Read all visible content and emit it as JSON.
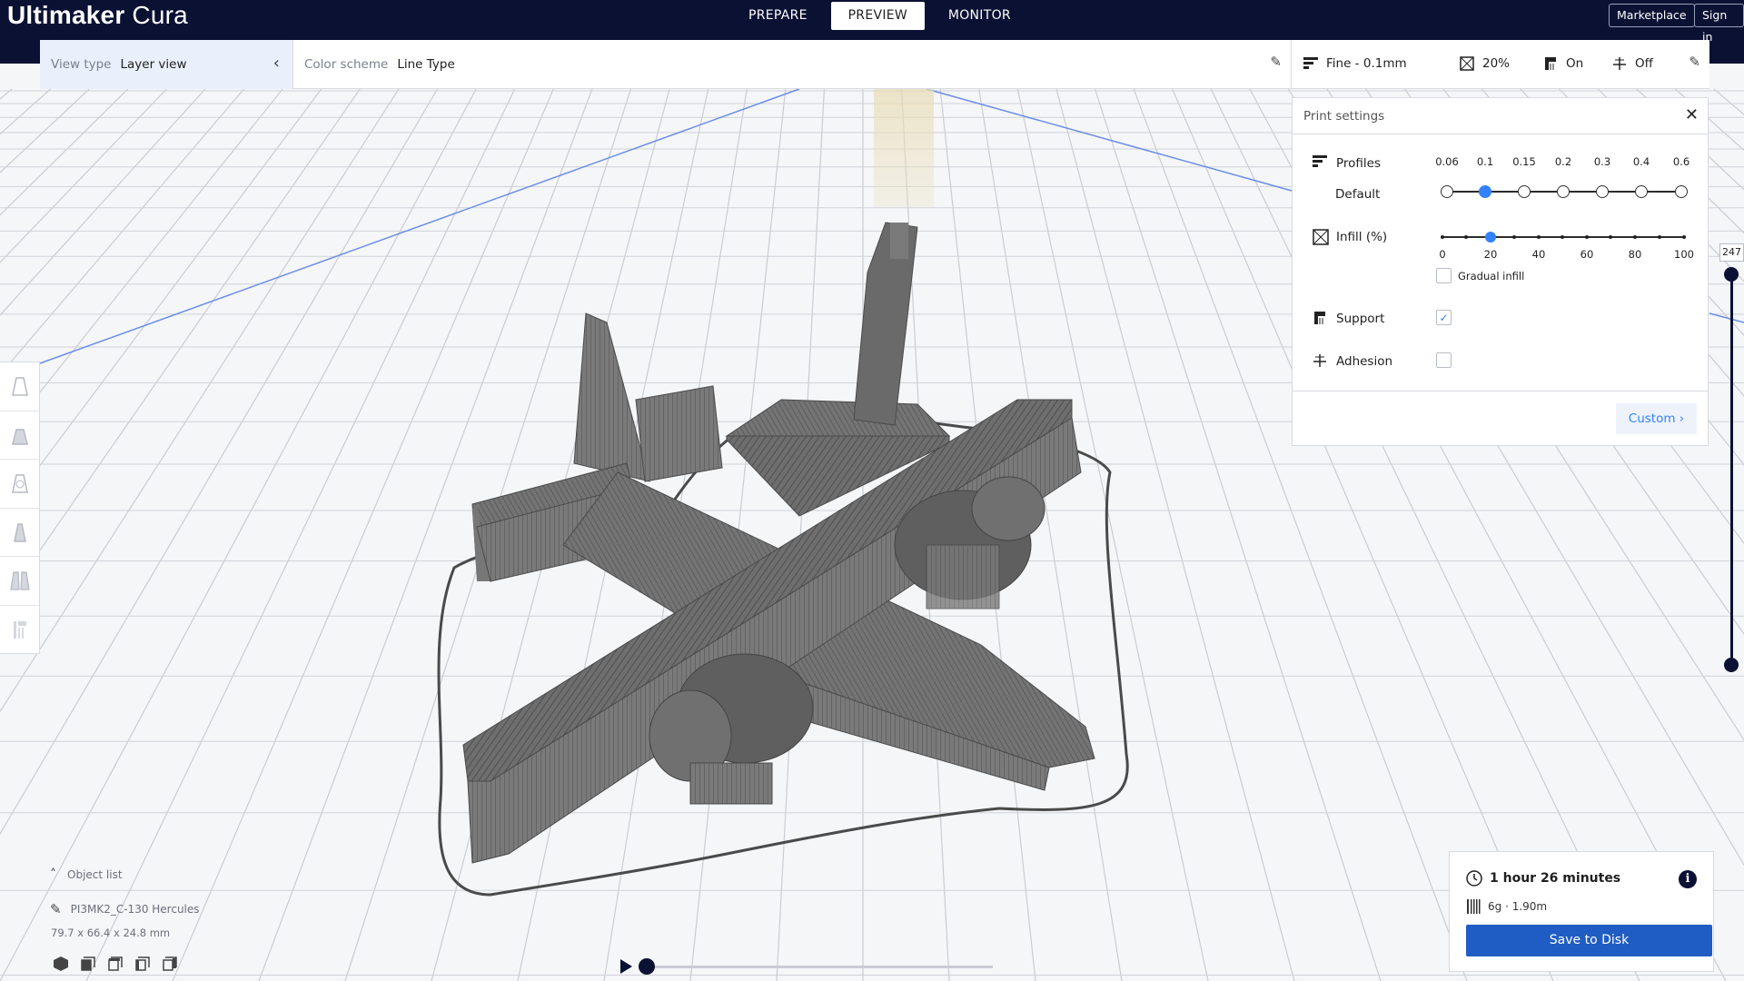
{
  "app": {
    "brand_bold": "Ultimaker",
    "brand_light": " Cura"
  },
  "stages": [
    {
      "label": "PREPARE",
      "active": false
    },
    {
      "label": "PREVIEW",
      "active": true
    },
    {
      "label": "MONITOR",
      "active": false
    }
  ],
  "topbar": {
    "marketplace": "Marketplace",
    "signin": "Sign in"
  },
  "viewbar": {
    "view_type_label": "View type",
    "view_type_value": "Layer view",
    "color_scheme_label": "Color scheme",
    "color_scheme_value": "Line Type"
  },
  "settings_summary": {
    "profile": "Fine - 0.1mm",
    "infill": "20%",
    "support": "On",
    "adhesion": "Off"
  },
  "print_settings": {
    "title": "Print settings",
    "profiles_label": "Profiles",
    "profiles_sub": "Default",
    "profile_ticks": [
      "0.06",
      "0.1",
      "0.15",
      "0.2",
      "0.3",
      "0.4",
      "0.6"
    ],
    "profile_selected_index": 1,
    "infill_label": "Infill (%)",
    "infill_ticks": [
      "0",
      "20",
      "40",
      "60",
      "80",
      "100"
    ],
    "infill_value": 20,
    "gradual_infill_label": "Gradual infill",
    "gradual_infill_checked": false,
    "support_label": "Support",
    "support_checked": true,
    "adhesion_label": "Adhesion",
    "adhesion_checked": false,
    "custom_button": "Custom"
  },
  "layer_slider": {
    "top_layer": "247"
  },
  "object_list": {
    "toggle_label": "Object list",
    "object_name": "PI3MK2_C-130 Hercules",
    "dimensions": "79.7 x 66.4 x 24.8 mm"
  },
  "output": {
    "print_time": "1 hour 26 minutes",
    "material": "6g · 1.90m",
    "save_button": "Save to Disk"
  },
  "colors": {
    "header_bg": "#0b1133",
    "accent_blue": "#3282ff",
    "save_button_bg": "#1f5dc4",
    "model_gray": "#6c6c6c"
  }
}
